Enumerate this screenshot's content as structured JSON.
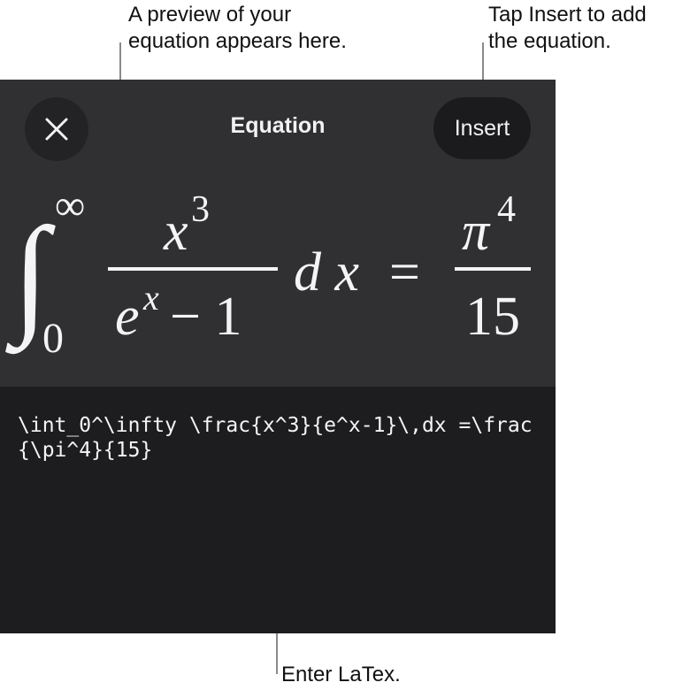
{
  "callouts": {
    "preview": [
      "A preview of your",
      "equation appears here."
    ],
    "insert": [
      "Tap Insert to add",
      "the equation."
    ],
    "latex": "Enter LaTex."
  },
  "dialog": {
    "title": "Equation",
    "close_icon": "close-icon",
    "insert_label": "Insert"
  },
  "formula": {
    "integral_sign": "∫",
    "upper_limit": "∞",
    "lower_limit": "0",
    "numerator_base": "x",
    "numerator_exp": "3",
    "denominator_base": "e",
    "denominator_exp": "x",
    "denominator_rest": "− 1",
    "differential": "d x",
    "equals": "=",
    "rhs_numerator_base": "π",
    "rhs_numerator_exp": "4",
    "rhs_denominator": "15"
  },
  "editor": {
    "latex": "\\int_0^\\infty \\frac{x^3}{e^x-1}\\,dx =\\frac{\\pi^4}{15}"
  },
  "colors": {
    "preview_bg": "#303032",
    "editor_bg": "#1d1d1f",
    "text": "#f4f4f4"
  }
}
